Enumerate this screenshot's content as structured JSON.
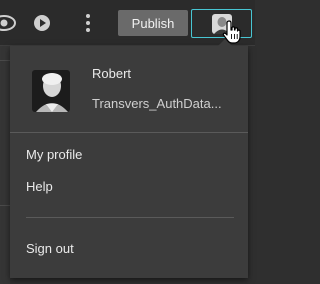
{
  "toolbar": {
    "publish_label": "Publish",
    "icons": [
      "eye-icon",
      "play-icon",
      "more-vertical-icon",
      "avatar",
      "hand-cursor-icon"
    ]
  },
  "user_menu": {
    "user_name": "Robert",
    "account": "Transvers_AuthData...",
    "items": [
      {
        "label": "My profile"
      },
      {
        "label": "Help"
      },
      {
        "label": "Sign out"
      }
    ]
  },
  "colors": {
    "accent": "#48c6d3",
    "menu_bg": "#3c3c3c",
    "toolbar_bg": "#2b2b2b",
    "button_bg": "#6a6a6a"
  }
}
